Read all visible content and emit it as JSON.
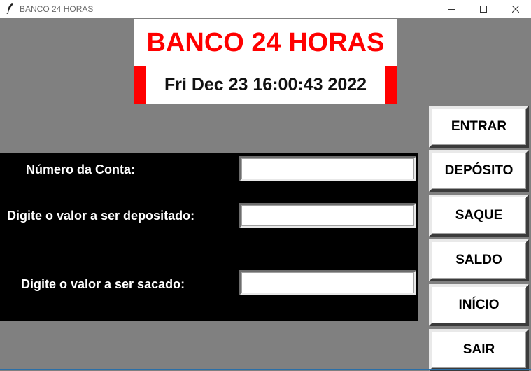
{
  "window": {
    "title": "BANCO 24 HORAS",
    "icon": "feather-icon"
  },
  "header": {
    "title": "BANCO 24 HORAS",
    "clock": "Fri Dec 23 16:00:43 2022"
  },
  "form": {
    "account_label": "Número da Conta:",
    "deposit_label": "Digite o valor a ser depositado:",
    "withdraw_label": "Digite o valor a ser sacado:",
    "account_value": "",
    "deposit_value": "",
    "withdraw_value": ""
  },
  "buttons": {
    "enter": "ENTRAR",
    "deposit": "DEPÓSITO",
    "withdraw": "SAQUE",
    "balance": "SALDO",
    "home": "INÍCIO",
    "exit": "SAIR"
  },
  "colors": {
    "background": "#808080",
    "accent": "#ff0000",
    "panel": "#000000"
  }
}
